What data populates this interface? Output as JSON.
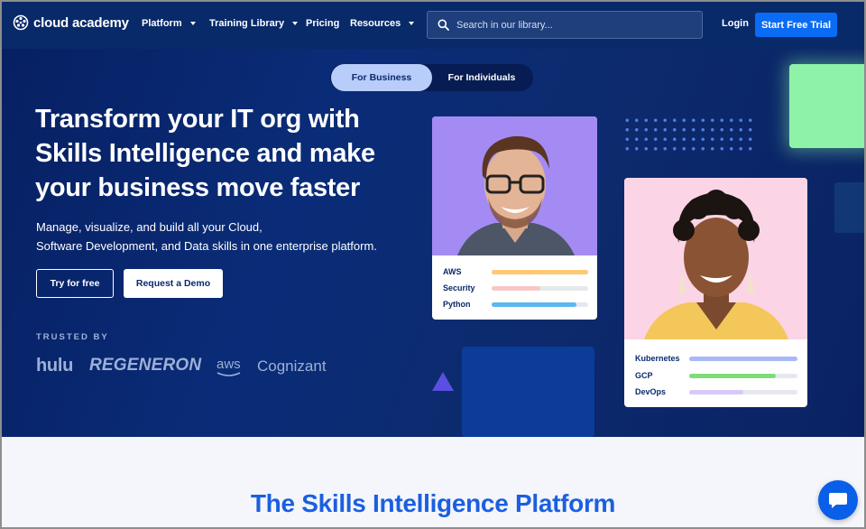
{
  "nav": {
    "logo": "cloud academy",
    "items": [
      {
        "label": "Platform",
        "dropdown": true
      },
      {
        "label": "Training Library",
        "dropdown": true
      },
      {
        "label": "Pricing",
        "dropdown": false
      },
      {
        "label": "Resources",
        "dropdown": true
      }
    ],
    "search_placeholder": "Search in our library...",
    "login": "Login",
    "cta": "Start Free Trial"
  },
  "hero": {
    "toggle": {
      "business": "For Business",
      "individuals": "For Individuals"
    },
    "headline": "Transform your IT org with Skills Intelligence and make your business move faster",
    "subtitle_line1": "Manage, visualize, and build all your Cloud,",
    "subtitle_line2": "Software Development, and Data skills in one enterprise platform.",
    "try_button": "Try for free",
    "demo_button": "Request a Demo",
    "trusted_by": "TRUSTED BY",
    "brands": [
      "hulu",
      "REGENERON",
      "aws",
      "Cognizant"
    ]
  },
  "card1": {
    "skills": [
      {
        "name": "AWS",
        "level": 1.0,
        "color": "#ffc874"
      },
      {
        "name": "Security",
        "level": 0.5,
        "color": "#f9c6c6"
      },
      {
        "name": "Python",
        "level": 0.88,
        "color": "#5ab8f0"
      }
    ]
  },
  "card2": {
    "skills": [
      {
        "name": "Kubernetes",
        "level": 1.0,
        "color": "#a9b8f8"
      },
      {
        "name": "GCP",
        "level": 0.8,
        "color": "#7fdc78"
      },
      {
        "name": "DevOps",
        "level": 0.5,
        "color": "#d8c9f6"
      }
    ]
  },
  "section": {
    "title": "The Skills Intelligence Platform"
  },
  "colors": {
    "nav_bg": "#082a69",
    "cta_blue": "#0a6cf5",
    "accent_green": "#8ef2a8"
  }
}
